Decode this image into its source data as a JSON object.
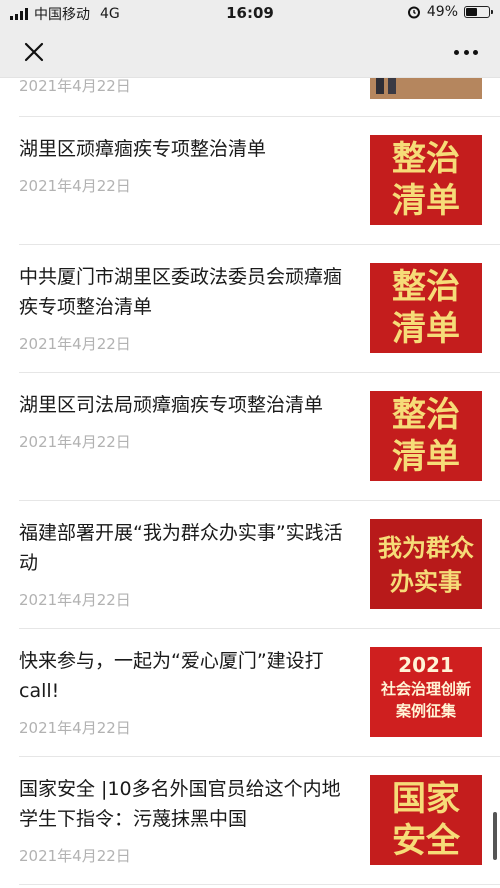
{
  "status_bar": {
    "carrier": "中国移动",
    "network": "4G",
    "time": "16:09",
    "battery_percent": "49%",
    "battery_level": 0.49
  },
  "nav": {
    "close_icon": "close-icon",
    "more_icon": "more-icon"
  },
  "articles": [
    {
      "title": "",
      "date": "2021年4月22日",
      "thumb_text": []
    },
    {
      "title": "湖里区顽瘴痼疾专项整治清单",
      "date": "2021年4月22日",
      "thumb_text": [
        "整治",
        "清单"
      ]
    },
    {
      "title": "中共厦门市湖里区委政法委员会顽瘴痼疾专项整治清单",
      "date": "2021年4月22日",
      "thumb_text": [
        "整治",
        "清单"
      ]
    },
    {
      "title": "湖里区司法局顽瘴痼疾专项整治清单",
      "date": "2021年4月22日",
      "thumb_text": [
        "整治",
        "清单"
      ]
    },
    {
      "title": "福建部署开展“我为群众办实事”实践活动",
      "date": "2021年4月22日",
      "thumb_text": [
        "我为群众",
        "办实事"
      ]
    },
    {
      "title": "快来参与，一起为“爱心厦门”建设打call!",
      "date": "2021年4月22日",
      "thumb_text": [
        "2021",
        "社会治理创新",
        "案例征集"
      ]
    },
    {
      "title": "国家安全 |10多名外国官员给这个内地学生下指令：污蔑抹黑中国",
      "date": "2021年4月22日",
      "thumb_text": [
        "国家",
        "安全"
      ]
    }
  ],
  "colors": {
    "thumb_red": "#c41d1d",
    "thumb_gold": "#f6dc78",
    "date_gray": "#b2b2b2",
    "bar_bg": "#ededed"
  }
}
